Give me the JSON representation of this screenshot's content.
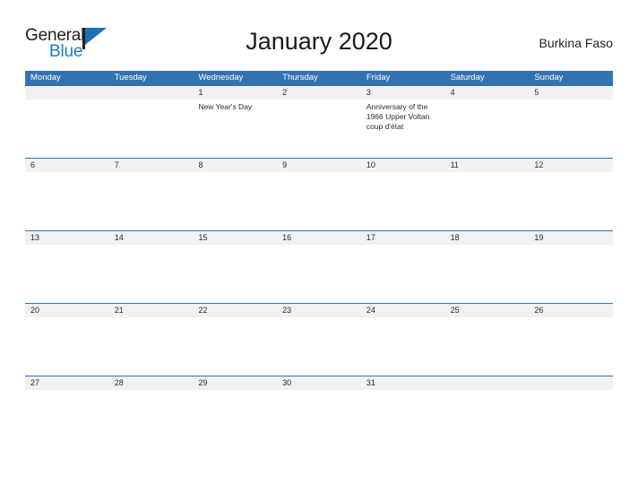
{
  "brand": {
    "word_one": "General",
    "word_two": "Blue",
    "flag_icon": "flag-triangle-icon",
    "color_dark": "#231f20",
    "color_blue": "#1f7ac4"
  },
  "header": {
    "title": "January 2020",
    "country": "Burkina Faso"
  },
  "theme": {
    "header_blue": "#3372b0",
    "date_band_gray": "#f1f1f1",
    "text_dark": "#2b2b2b"
  },
  "calendar": {
    "weekdays": [
      "Monday",
      "Tuesday",
      "Wednesday",
      "Thursday",
      "Friday",
      "Saturday",
      "Sunday"
    ],
    "weeks": [
      {
        "days": [
          {
            "num": "",
            "event": ""
          },
          {
            "num": "",
            "event": ""
          },
          {
            "num": "1",
            "event": "New Year's Day"
          },
          {
            "num": "2",
            "event": ""
          },
          {
            "num": "3",
            "event": "Anniversary of the 1966 Upper Voltan coup d'état"
          },
          {
            "num": "4",
            "event": ""
          },
          {
            "num": "5",
            "event": ""
          }
        ]
      },
      {
        "days": [
          {
            "num": "6",
            "event": ""
          },
          {
            "num": "7",
            "event": ""
          },
          {
            "num": "8",
            "event": ""
          },
          {
            "num": "9",
            "event": ""
          },
          {
            "num": "10",
            "event": ""
          },
          {
            "num": "11",
            "event": ""
          },
          {
            "num": "12",
            "event": ""
          }
        ]
      },
      {
        "days": [
          {
            "num": "13",
            "event": ""
          },
          {
            "num": "14",
            "event": ""
          },
          {
            "num": "15",
            "event": ""
          },
          {
            "num": "16",
            "event": ""
          },
          {
            "num": "17",
            "event": ""
          },
          {
            "num": "18",
            "event": ""
          },
          {
            "num": "19",
            "event": ""
          }
        ]
      },
      {
        "days": [
          {
            "num": "20",
            "event": ""
          },
          {
            "num": "21",
            "event": ""
          },
          {
            "num": "22",
            "event": ""
          },
          {
            "num": "23",
            "event": ""
          },
          {
            "num": "24",
            "event": ""
          },
          {
            "num": "25",
            "event": ""
          },
          {
            "num": "26",
            "event": ""
          }
        ]
      },
      {
        "days": [
          {
            "num": "27",
            "event": ""
          },
          {
            "num": "28",
            "event": ""
          },
          {
            "num": "29",
            "event": ""
          },
          {
            "num": "30",
            "event": ""
          },
          {
            "num": "31",
            "event": ""
          },
          {
            "num": "",
            "event": ""
          },
          {
            "num": "",
            "event": ""
          }
        ]
      }
    ]
  }
}
